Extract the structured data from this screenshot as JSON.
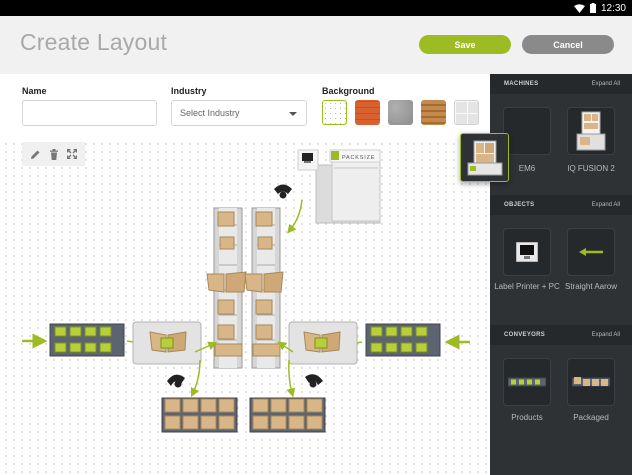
{
  "statusbar": {
    "time": "12:30"
  },
  "header": {
    "title": "Create Layout",
    "save_label": "Save",
    "cancel_label": "Cancel"
  },
  "form": {
    "name_label": "Name",
    "name_value": "",
    "industry_label": "Industry",
    "industry_placeholder": "Select Industry",
    "background_label": "Background",
    "backgrounds": [
      {
        "name": "dots-white",
        "color": "#ffffff",
        "selected": true
      },
      {
        "name": "brick",
        "color": "#d9612f",
        "selected": false
      },
      {
        "name": "concrete",
        "color": "#9b9b9b",
        "selected": false
      },
      {
        "name": "wood",
        "color": "#b57b3e",
        "selected": false
      },
      {
        "name": "tiles",
        "color": "#e2e2e2",
        "selected": false
      }
    ]
  },
  "toolbar": [
    "pencil-icon",
    "trash-icon",
    "expand-icon"
  ],
  "canvas": {
    "brand_text": "PACKSIZE"
  },
  "sidebar": {
    "machines": {
      "title": "MACHINES",
      "expand": "Expand All",
      "items": [
        {
          "label": "EM6"
        },
        {
          "label": "IQ FUSION 2"
        }
      ]
    },
    "objects": {
      "title": "OBJECTS",
      "expand": "Expand All",
      "items": [
        {
          "label": "Label Printer + PC"
        },
        {
          "label": "Straight Aarow"
        }
      ]
    },
    "conveyors": {
      "title": "CONVEYORS",
      "expand": "Expand All",
      "items": [
        {
          "label": "Products"
        },
        {
          "label": "Packaged"
        }
      ]
    }
  },
  "colors": {
    "accent": "#9dbb22",
    "sidebar": "#2f3235",
    "cardboard": "#d8b688"
  }
}
